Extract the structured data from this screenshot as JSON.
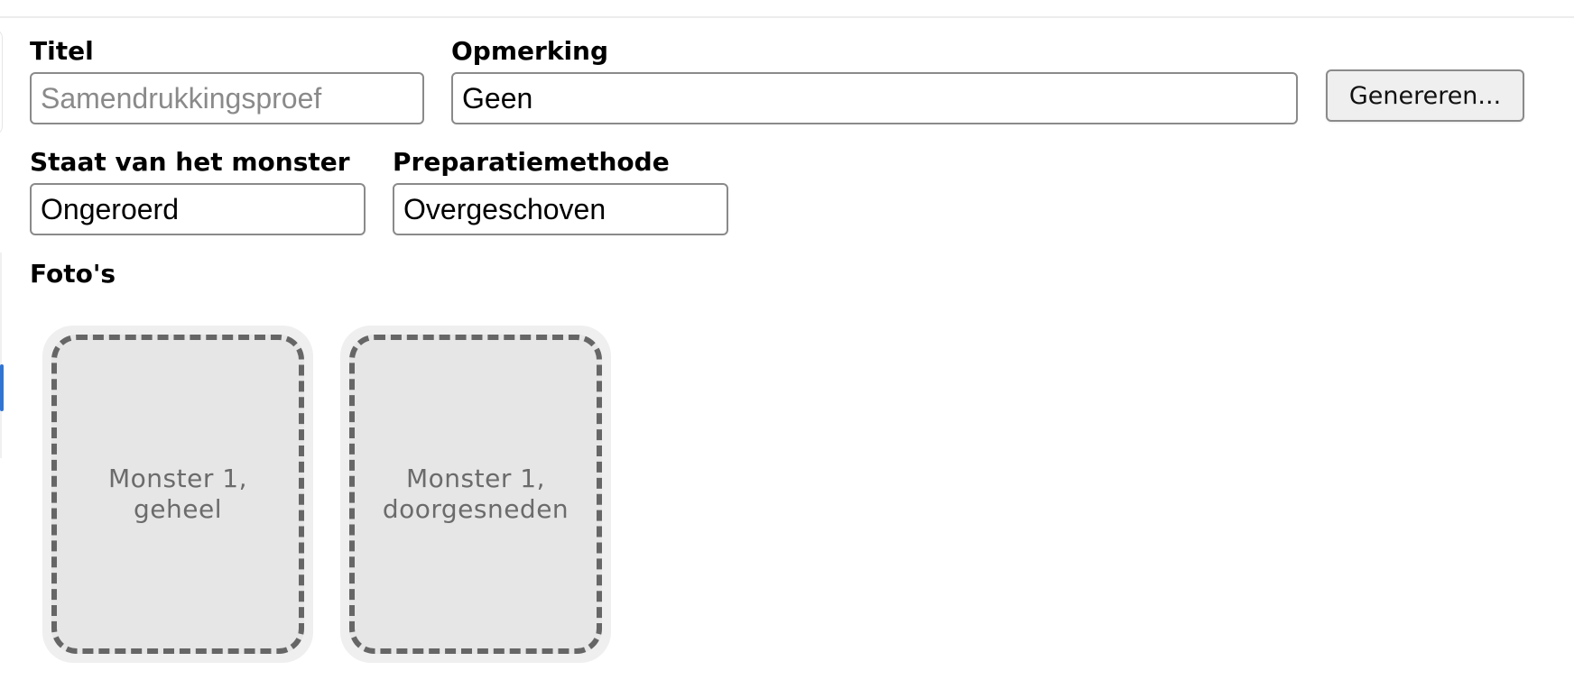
{
  "form": {
    "title": {
      "label": "Titel",
      "value": "",
      "placeholder": "Samendrukkingsproef"
    },
    "remark": {
      "label": "Opmerking",
      "value": "Geen"
    },
    "generate_button_label": "Genereren...",
    "sample_state": {
      "label": "Staat van het monster",
      "value": "Ongeroerd"
    },
    "preparation_method": {
      "label": "Preparatiemethode",
      "value": "Overgeschoven"
    }
  },
  "photos": {
    "label": "Foto's",
    "items": [
      {
        "label": "Monster 1,\ngeheel"
      },
      {
        "label": "Monster 1,\ndoorgesneden"
      }
    ]
  },
  "colors": {
    "border": "#8a8a8a",
    "placeholder": "#8a8a8a",
    "photo_card_bg": "#efefef",
    "photo_dropzone_bg": "#e6e6e6",
    "photo_dashed_border": "#666666",
    "button_bg": "#efefef"
  }
}
